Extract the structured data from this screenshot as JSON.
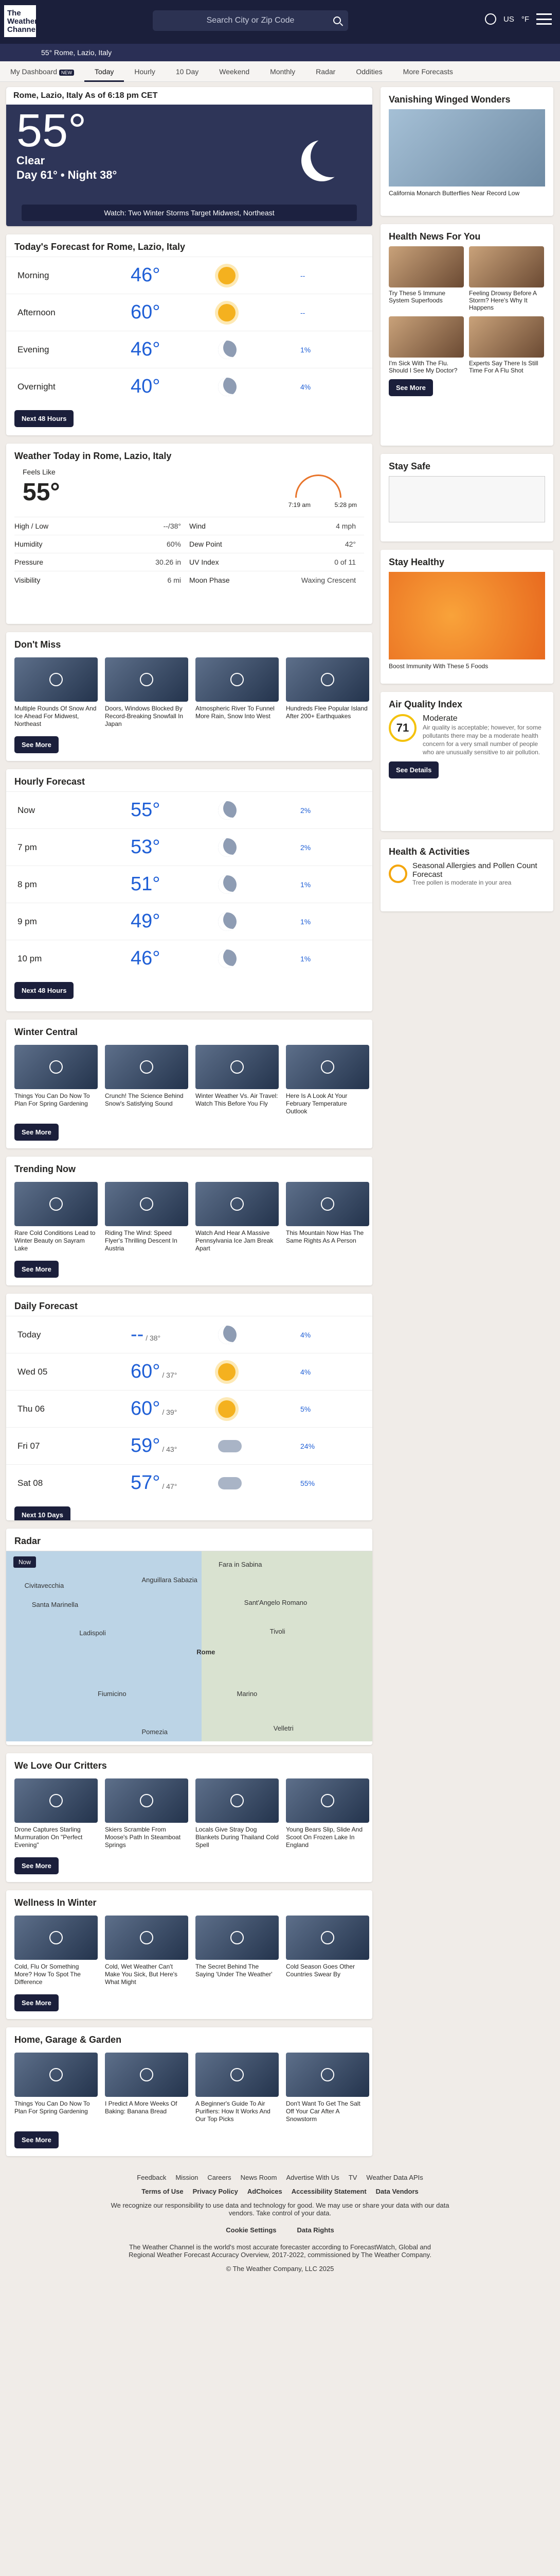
{
  "header": {
    "logo": "The Weather Channel",
    "search_placeholder": "Search City or Zip Code",
    "region": "US",
    "unit": "°F"
  },
  "locbar": {
    "text": "55° Rome, Lazio, Italy"
  },
  "nav": [
    "My Dashboard",
    "Today",
    "Hourly",
    "10 Day",
    "Weekend",
    "Monthly",
    "Radar",
    "Oddities",
    "More Forecasts"
  ],
  "nav_badge": "NEW",
  "current": {
    "title": "Rome, Lazio, Italy As of 6:18 pm CET",
    "temp": "55°",
    "phrase": "Clear",
    "daynight": "Day 61° • Night 38°",
    "watch": "Watch:  Two Winter Storms Target Midwest, Northeast"
  },
  "today": {
    "title": "Today's Forecast for Rome, Lazio, Italy",
    "rows": [
      {
        "t": "Morning",
        "temp": "46°",
        "p": "--"
      },
      {
        "t": "Afternoon",
        "temp": "60°",
        "p": "--"
      },
      {
        "t": "Evening",
        "temp": "46°",
        "p": "1%"
      },
      {
        "t": "Overnight",
        "temp": "40°",
        "p": "4%"
      }
    ],
    "btn": "Next 48 Hours"
  },
  "weather_today": {
    "title": "Weather Today in Rome, Lazio, Italy",
    "feels_label": "Feels Like",
    "feels": "55°",
    "sunrise": "7:19 am",
    "sunset": "5:28 pm",
    "details": [
      [
        "High / Low",
        "--/38°"
      ],
      [
        "Wind",
        "4 mph"
      ],
      [
        "Humidity",
        "60%"
      ],
      [
        "Dew Point",
        "42°"
      ],
      [
        "Pressure",
        "30.26 in"
      ],
      [
        "UV Index",
        "0 of 11"
      ],
      [
        "Visibility",
        "6 mi"
      ],
      [
        "Moon Phase",
        "Waxing Crescent"
      ]
    ]
  },
  "dont_miss": {
    "title": "Don't Miss",
    "items": [
      "Multiple Rounds Of Snow And Ice Ahead For Midwest, Northeast",
      "Doors, Windows Blocked By Record-Breaking Snowfall In Japan",
      "Atmospheric River To Funnel More Rain, Snow Into West",
      "Hundreds Flee Popular Island After 200+ Earthquakes"
    ],
    "btn": "See More"
  },
  "hourly": {
    "title": "Hourly Forecast",
    "rows": [
      {
        "t": "Now",
        "temp": "55°",
        "p": "2%"
      },
      {
        "t": "7 pm",
        "temp": "53°",
        "p": "2%"
      },
      {
        "t": "8 pm",
        "temp": "51°",
        "p": "1%"
      },
      {
        "t": "9 pm",
        "temp": "49°",
        "p": "1%"
      },
      {
        "t": "10 pm",
        "temp": "46°",
        "p": "1%"
      }
    ],
    "btn": "Next 48 Hours"
  },
  "winter": {
    "title": "Winter Central",
    "items": [
      "Things You Can Do Now To Plan For Spring Gardening",
      "Crunch! The Science Behind Snow's Satisfying Sound",
      "Winter Weather Vs. Air Travel: Watch This Before You Fly",
      "Here Is A Look At Your February Temperature Outlook"
    ],
    "btn": "See More"
  },
  "trending": {
    "title": "Trending Now",
    "items": [
      "Rare Cold Conditions Lead to Winter Beauty on Sayram Lake",
      "Riding The Wind: Speed Flyer's Thrilling Descent In Austria",
      "Watch And Hear A Massive Pennsylvania Ice Jam Break Apart",
      "This Mountain Now Has The Same Rights As A Person"
    ],
    "btn": "See More"
  },
  "daily": {
    "title": "Daily Forecast",
    "rows": [
      {
        "t": "Today",
        "temp": "--",
        "lo": "/ 38°",
        "p": "4%"
      },
      {
        "t": "Wed 05",
        "temp": "60°",
        "lo": "/ 37°",
        "p": "4%"
      },
      {
        "t": "Thu 06",
        "temp": "60°",
        "lo": "/ 39°",
        "p": "5%"
      },
      {
        "t": "Fri 07",
        "temp": "59°",
        "lo": "/ 43°",
        "p": "24%"
      },
      {
        "t": "Sat 08",
        "temp": "57°",
        "lo": "/ 47°",
        "p": "55%"
      }
    ],
    "btn": "Next 10 Days"
  },
  "radar": {
    "title": "Radar",
    "now": "Now",
    "places": [
      "Fara in Sabina",
      "Civitavecchia",
      "Anguillara Sabazia",
      "Santa Marinella",
      "Sant'Angelo Romano",
      "Ladispoli",
      "Tivoli",
      "Rome",
      "Fiumicino",
      "Marino",
      "Pomezia",
      "Velletri"
    ]
  },
  "critters": {
    "title": "We Love Our Critters",
    "items": [
      "Drone Captures Starling Murmuration On \"Perfect Evening\"",
      "Skiers Scramble From Moose's Path In Steamboat Springs",
      "Locals Give Stray Dog Blankets During Thailand Cold Spell",
      "Young Bears Slip, Slide And Scoot On Frozen Lake In England"
    ],
    "btn": "See More"
  },
  "wellness": {
    "title": "Wellness In Winter",
    "items": [
      "Cold, Flu Or Something More? How To Spot The Difference",
      "Cold, Wet Weather Can't Make You Sick, But Here's What Might",
      "The Secret Behind The Saying 'Under The Weather'",
      "Cold Season Goes Other Countries Swear By"
    ],
    "btn": "See More"
  },
  "garden": {
    "title": "Home, Garage & Garden",
    "items": [
      "Things You Can Do Now To Plan For Spring Gardening",
      "I Predict A More Weeks Of Baking: Banana Bread",
      "A Beginner's Guide To Air Purifiers: How It Works And Our Top Picks",
      "Don't Want To Get The Salt Off Your Car After A Snowstorm"
    ],
    "btn": "See More"
  },
  "right": {
    "vanish": {
      "title": "Vanishing Winged Wonders",
      "caption": "California Monarch Butterflies Near Record Low"
    },
    "health": {
      "title": "Health News For You",
      "items": [
        "Try These 5 Immune System Superfoods",
        "Feeling Drowsy Before A Storm? Here's Why It Happens",
        "I'm Sick With The Flu. Should I See My Doctor?",
        "Experts Say There Is Still Time For A Flu Shot"
      ],
      "btn": "See More"
    },
    "safe": {
      "title": "Stay Safe"
    },
    "healthy": {
      "title": "Stay Healthy",
      "caption": "Boost Immunity With These 5 Foods"
    },
    "aqi": {
      "title": "Air Quality Index",
      "value": "71",
      "level": "Moderate",
      "desc": "Air quality is acceptable; however, for some pollutants there may be a moderate health concern for a very small number of people who are unusually sensitive to air pollution.",
      "btn": "See Details"
    },
    "activities": {
      "title": "Health & Activities",
      "item": "Seasonal Allergies and Pollen Count Forecast",
      "sub": "Tree pollen is moderate in your area"
    }
  },
  "footer": {
    "links": [
      "Feedback",
      "Mission",
      "Careers",
      "News Room",
      "Advertise With Us",
      "TV",
      "Weather Data APIs"
    ],
    "links2": [
      "Terms of Use",
      "Privacy Policy",
      "AdChoices",
      "Accessibility Statement",
      "Data Vendors"
    ],
    "resp": "We recognize our responsibility to use data and technology for good. We may use or share your data with our data vendors. Take control of your data.",
    "btns": [
      "Cookie Settings",
      "Data Rights"
    ],
    "accuracy": "The Weather Channel is the world's most accurate forecaster according to ForecastWatch, Global and Regional Weather Forecast Accuracy Overview, 2017-2022, commissioned by The Weather Company.",
    "copy": "© The Weather Company, LLC 2025"
  }
}
